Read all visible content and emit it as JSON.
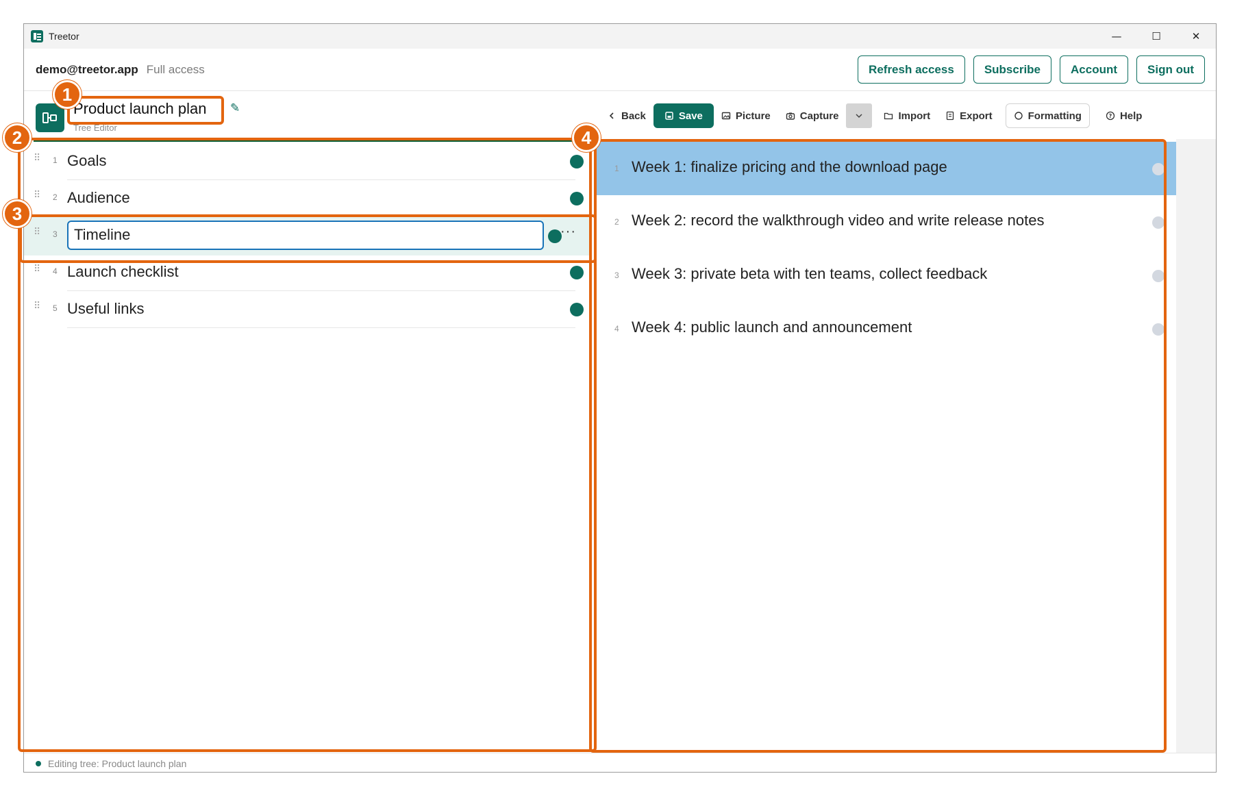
{
  "window": {
    "title": "Treetor",
    "controls": {
      "minimize": "—",
      "maximize": "☐",
      "close": "✕"
    }
  },
  "account": {
    "email": "demo@treetor.app",
    "access_level": "Full access",
    "buttons": [
      "Refresh access",
      "Subscribe",
      "Account",
      "Sign out"
    ]
  },
  "document": {
    "title": "Product launch plan",
    "subtitle": "Tree Editor"
  },
  "toolbar": {
    "back": "Back",
    "save": "Save",
    "picture": "Picture",
    "capture": "Capture",
    "import": "Import",
    "export": "Export",
    "formatting": "Formatting",
    "help": "Help"
  },
  "tree": {
    "selected_index": 2,
    "items": [
      {
        "num": "1",
        "label": "Goals"
      },
      {
        "num": "2",
        "label": "Audience"
      },
      {
        "num": "3",
        "label": "Timeline"
      },
      {
        "num": "4",
        "label": "Launch checklist"
      },
      {
        "num": "5",
        "label": "Useful links"
      }
    ]
  },
  "details": {
    "active_index": 0,
    "items": [
      {
        "num": "1",
        "text": "Week 1: finalize pricing and the download page"
      },
      {
        "num": "2",
        "text": "Week 2: record the walkthrough video and write release notes"
      },
      {
        "num": "3",
        "text": "Week 3: private beta with ten teams, collect feedback"
      },
      {
        "num": "4",
        "text": "Week 4: public launch and announcement"
      }
    ]
  },
  "status": {
    "text": "Editing tree: Product launch plan"
  },
  "annotations": [
    "1",
    "2",
    "3",
    "4"
  ],
  "colors": {
    "brand": "#0d6e5f",
    "annotation": "#e3650f",
    "active_row": "#93c4e8"
  }
}
